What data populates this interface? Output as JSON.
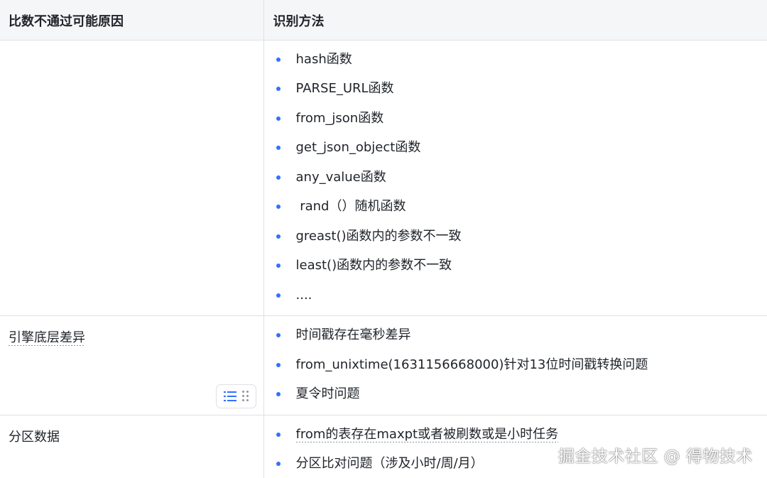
{
  "table": {
    "headers": [
      "比数不通过可能原因",
      "识别方法"
    ],
    "rows": [
      {
        "reason": "",
        "methods": [
          "hash函数",
          "PARSE_URL函数",
          "from_json函数",
          "get_json_object函数",
          "any_value函数",
          " rand（）随机函数",
          "greast()函数内的参数不一致",
          "least()函数内的参数不一致",
          "...."
        ]
      },
      {
        "reason": "引擎底层差异",
        "methods": [
          "时间戳存在毫秒差异",
          "from_unixtime(1631156668000)针对13位时间戳转换问题",
          "夏令时问题"
        ]
      },
      {
        "reason": "分区数据",
        "methods": [
          "from的表存在maxpt或者被刷数或是小时任务",
          "分区比对问题（涉及小时/周/月）"
        ]
      }
    ]
  },
  "cell_toolbar": {
    "icons": [
      "list-icon",
      "drag-handle-icon"
    ]
  },
  "watermark": "掘金技术社区 @ 得物技术",
  "colors": {
    "bullet": "#3370ff",
    "border": "#dee0e3",
    "header_bg": "#f5f6f7"
  }
}
